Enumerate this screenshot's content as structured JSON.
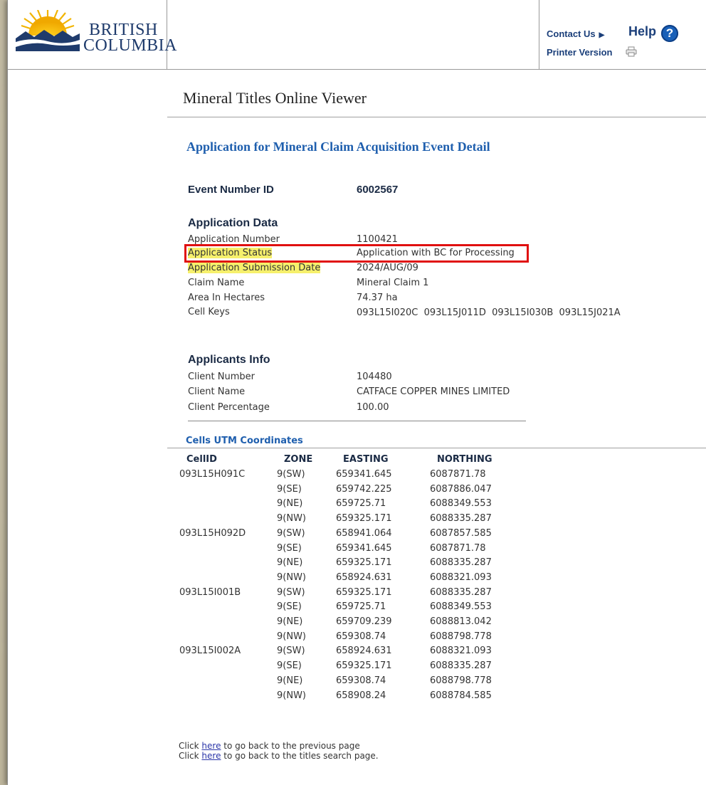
{
  "header": {
    "logo_line1": "BRITISH",
    "logo_line2": "COLUMBIA",
    "contact_label": "Contact Us",
    "help_label": "Help",
    "printer_label": "Printer Version"
  },
  "page_title": "Mineral Titles Online Viewer",
  "event_title": "Application for Mineral Claim Acquisition Event Detail",
  "event": {
    "label": "Event Number ID",
    "value": "6002567"
  },
  "application_data": {
    "heading": "Application Data",
    "rows": [
      {
        "label": "Application Number",
        "value": "1100421"
      },
      {
        "label": "Application Status",
        "value": "Application with BC for Processing"
      },
      {
        "label": "Application Submission Date",
        "value": "2024/AUG/09"
      },
      {
        "label": "Claim Name",
        "value": "Mineral Claim 1"
      },
      {
        "label": "Area In Hectares",
        "value": "74.37 ha"
      },
      {
        "label": "Cell Keys",
        "value": "093L15I020C  093L15J011D  093L15I030B  093L15J021A"
      }
    ]
  },
  "applicants": {
    "heading": "Applicants Info",
    "rows": [
      {
        "label": "Client Number",
        "value": "104480"
      },
      {
        "label": "Client Name",
        "value": "CATFACE COPPER MINES LIMITED"
      },
      {
        "label": "Client Percentage",
        "value": "100.00"
      }
    ]
  },
  "cells": {
    "title": "Cells UTM Coordinates",
    "headers": [
      "CellID",
      "ZONE",
      "EASTING",
      "NORTHING"
    ],
    "rows": [
      [
        "093L15H091C",
        "9(SW)",
        "659341.645",
        "6087871.78"
      ],
      [
        "",
        "9(SE)",
        "659742.225",
        "6087886.047"
      ],
      [
        "",
        "9(NE)",
        "659725.71",
        "6088349.553"
      ],
      [
        "",
        "9(NW)",
        "659325.171",
        "6088335.287"
      ],
      [
        "093L15H092D",
        "9(SW)",
        "658941.064",
        "6087857.585"
      ],
      [
        "",
        "9(SE)",
        "659341.645",
        "6087871.78"
      ],
      [
        "",
        "9(NE)",
        "659325.171",
        "6088335.287"
      ],
      [
        "",
        "9(NW)",
        "658924.631",
        "6088321.093"
      ],
      [
        "093L15I001B",
        "9(SW)",
        "659325.171",
        "6088335.287"
      ],
      [
        "",
        "9(SE)",
        "659725.71",
        "6088349.553"
      ],
      [
        "",
        "9(NE)",
        "659709.239",
        "6088813.042"
      ],
      [
        "",
        "9(NW)",
        "659308.74",
        "6088798.778"
      ],
      [
        "093L15I002A",
        "9(SW)",
        "658924.631",
        "6088321.093"
      ],
      [
        "",
        "9(SE)",
        "659325.171",
        "6088335.287"
      ],
      [
        "",
        "9(NE)",
        "659308.74",
        "6088798.778"
      ],
      [
        "",
        "9(NW)",
        "658908.24",
        "6088784.585"
      ]
    ]
  },
  "footer": {
    "line1_prefix": "Click ",
    "line1_link": "here",
    "line1_suffix": " to go back to the previous page",
    "line2_prefix": "Click ",
    "line2_link": "here",
    "line2_suffix": " to go back to the titles search page."
  }
}
